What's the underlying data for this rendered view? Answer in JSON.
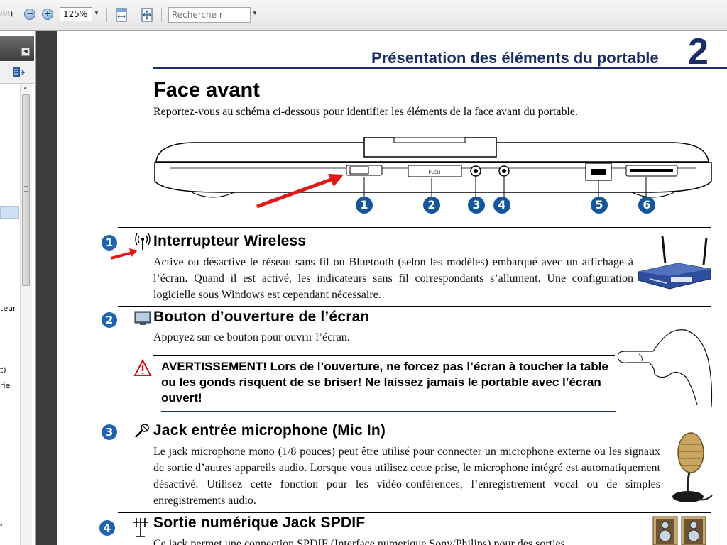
{
  "toolbar": {
    "page_fragment": "88)",
    "zoom_out_label": "−",
    "zoom_in_label": "+",
    "zoom_value": "125%",
    "search_placeholder": "Recherche r"
  },
  "left_panel": {
    "fragments": [
      "teur",
      "t)",
      "rie",
      "\""
    ]
  },
  "page": {
    "chapter_title": "Présentation des éléments du portable",
    "chapter_number": "2",
    "section_title": "Face avant",
    "section_desc": "Reportez-vous au schéma ci-dessous pour identifier les éléments de la face avant du portable.",
    "diagram_labels": [
      "1",
      "2",
      "3",
      "4",
      "5",
      "6"
    ],
    "push_label": "PUSH",
    "items": [
      {
        "number": "1",
        "title": "Interrupteur Wireless",
        "body": "Active ou désactive le réseau sans fil ou Bluetooth (selon les modèles) embarqué avec un affichage à l’écran. Quand il est activé, les indicateurs sans fil correspondants s’allument. Une configuration logicielle sous Windows est cependant nécessaire."
      },
      {
        "number": "2",
        "title": "Bouton d’ouverture de l’écran",
        "body": "Appuyez sur ce bouton pour ouvrir l’écran.",
        "warning": "AVERTISSEMENT! Lors de l’ouverture, ne forcez pas l’écran à toucher la table ou les gonds risquent de se briser! Ne laissez jamais le portable avec l’écran ouvert!"
      },
      {
        "number": "3",
        "title": "Jack entrée microphone (Mic In)",
        "body": "Le jack microphone mono (1/8 pouces) peut être utilisé pour connecter un microphone externe ou les signaux de sortie d’autres appareils audio. Lorsque vous utilisez cette prise, le microphone intégré est automatiquement désactivé. Utilisez cette fonction pour les vidéo-conférences, l’enregistrement vocal ou de simples enregistrements audio."
      },
      {
        "number": "4",
        "title": "Sortie numérique Jack SPDIF",
        "body": "Ce jack permet une connection SPDIF (Interface numerique Sony/Philips) pour des sorties"
      }
    ]
  },
  "colors": {
    "heading_blue": "#1a2d66",
    "badge_blue": "#1f64ac",
    "annotation_red": "#e01818"
  }
}
